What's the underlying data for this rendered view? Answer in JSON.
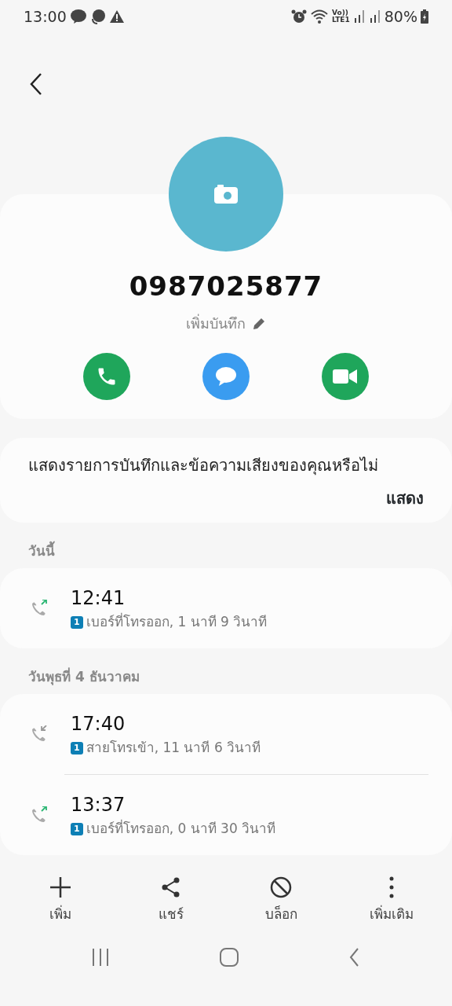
{
  "status_bar": {
    "time": "13:00",
    "volte": "Vo))",
    "network": "LTE1",
    "battery": "80%"
  },
  "contact": {
    "number": "0987025877",
    "note_label": "เพิ่มบันทึก"
  },
  "prompt": {
    "text": "แสดงรายการบันทึกและข้อความเสียงของคุณหรือไม่",
    "action": "แสดง"
  },
  "call_groups": [
    {
      "heading": "วันนี้",
      "calls": [
        {
          "kind": "outgoing",
          "time": "12:41",
          "sim": "1",
          "detail": "เบอร์ที่โทรออก, 1 นาที 9 วินาที"
        }
      ]
    },
    {
      "heading": "วันพุธที่ 4 ธันวาคม",
      "calls": [
        {
          "kind": "incoming",
          "time": "17:40",
          "sim": "1",
          "detail": "สายโทรเข้า, 11 นาที 6 วินาที"
        },
        {
          "kind": "outgoing",
          "time": "13:37",
          "sim": "1",
          "detail": "เบอร์ที่โทรออก, 0 นาที 30 วินาที"
        }
      ]
    }
  ],
  "bottom_actions": [
    {
      "kind": "add",
      "label": "เพิ่ม"
    },
    {
      "kind": "share",
      "label": "แชร์"
    },
    {
      "kind": "block",
      "label": "บล็อก"
    },
    {
      "kind": "more",
      "label": "เพิ่มเติม"
    }
  ]
}
